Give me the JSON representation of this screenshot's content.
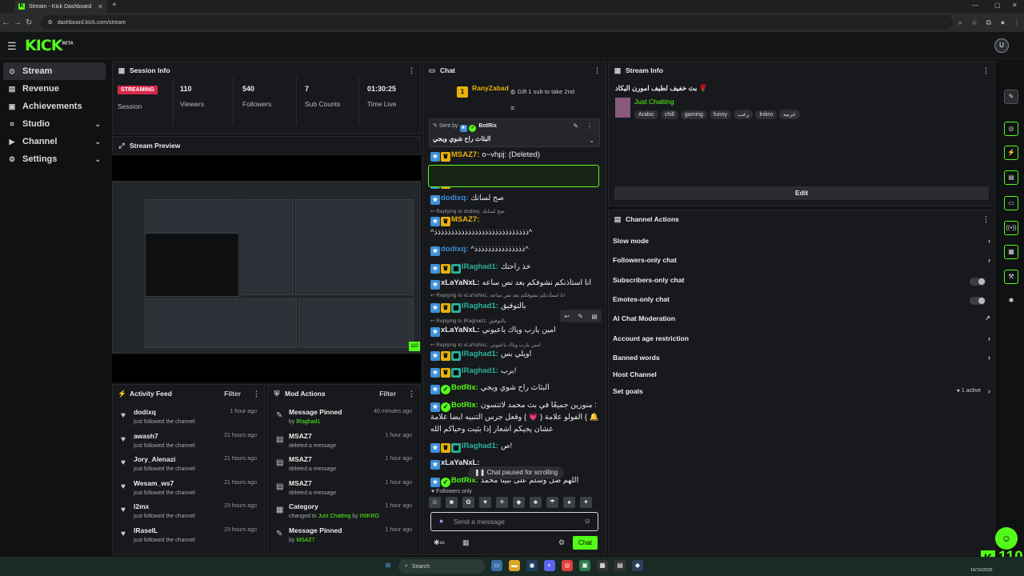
{
  "browser": {
    "tab_title": "Stream - Kick Dashboard",
    "url": "dashboard.kick.com/stream",
    "kick_icon": "K",
    "nav_icons": [
      "back-icon",
      "forward-icon",
      "reload-icon",
      "site-info-icon"
    ],
    "addr_icons": [
      "zoom-icon",
      "star-icon",
      "extensions-icon",
      "profile-icon",
      "menu-icon"
    ]
  },
  "app": {
    "logo": "KICK",
    "logo_beta": "BETA",
    "avatar": "U"
  },
  "sidebar": {
    "items": [
      {
        "label": "Stream",
        "icon": "stream-icon",
        "glyph": "((•))",
        "expandable": false,
        "active": true
      },
      {
        "label": "Revenue",
        "icon": "revenue-icon",
        "glyph": "▤",
        "expandable": false
      },
      {
        "label": "Achievements",
        "icon": "trophy-icon",
        "glyph": "▣",
        "expandable": false
      },
      {
        "label": "Studio",
        "icon": "studio-icon",
        "glyph": "⌗",
        "expandable": true
      },
      {
        "label": "Channel",
        "icon": "channel-icon",
        "glyph": "▶",
        "expandable": true
      },
      {
        "label": "Settings",
        "icon": "gear-icon",
        "glyph": "⚙",
        "expandable": true
      }
    ]
  },
  "session": {
    "title": "Session Info",
    "status_badge": "STREAMING",
    "status_label": "Session",
    "stats": [
      {
        "value": "110",
        "label": "Viewers"
      },
      {
        "value": "540",
        "label": "Followers"
      },
      {
        "value": "7",
        "label": "Sub Counts"
      },
      {
        "value": "01:30:25",
        "label": "Time Live"
      }
    ]
  },
  "preview": {
    "title": "Stream Preview",
    "viewer_count": "110"
  },
  "activity": {
    "title": "Activity Feed",
    "filter": "Filter",
    "items": [
      {
        "name": "dodixq",
        "desc": "just followed the channel",
        "time": "1 hour ago"
      },
      {
        "name": "awash7",
        "desc": "just followed the channel",
        "time": "21 hours ago"
      },
      {
        "name": "Jory_Alenazi",
        "desc": "just followed the channel",
        "time": "21 hours ago"
      },
      {
        "name": "Wesam_ws7",
        "desc": "just followed the channel",
        "time": "21 hours ago"
      },
      {
        "name": "l2mx",
        "desc": "just followed the channel",
        "time": "23 hours ago"
      },
      {
        "name": "lRaseIL",
        "desc": "just followed the channel",
        "time": "23 hours ago"
      }
    ]
  },
  "mod": {
    "title": "Mod Actions",
    "filter": "Filter",
    "items": [
      {
        "name": "Message Pinned",
        "pre": "by ",
        "who": "lRaghad1",
        "post": "",
        "desc2": "",
        "time": "40 minutes ago",
        "icon": "pin-icon",
        "glyph": "✎"
      },
      {
        "name": "MSAZ7",
        "pre": "deleted a message",
        "who": "",
        "post": "",
        "desc2": "",
        "time": "1 hour ago",
        "icon": "trash-icon",
        "glyph": "🗑"
      },
      {
        "name": "MSAZ7",
        "pre": "deleted a message",
        "who": "",
        "post": "",
        "desc2": "",
        "time": "1 hour ago",
        "icon": "trash-icon",
        "glyph": "🗑"
      },
      {
        "name": "MSAZ7",
        "pre": "deleted a message",
        "who": "",
        "post": "",
        "desc2": "",
        "time": "1 hour ago",
        "icon": "trash-icon",
        "glyph": "🗑"
      },
      {
        "name": "Category",
        "pre": "changed to ",
        "who": "Just Chatting",
        "post": " by ",
        "desc2": "INIKRO",
        "time": "1 hour ago",
        "icon": "category-icon",
        "glyph": "▦"
      },
      {
        "name": "Message Pinned",
        "pre": "by ",
        "who": "MSAZ7",
        "post": "",
        "desc2": "",
        "time": "1 hour ago",
        "icon": "pin-icon",
        "glyph": "✎"
      }
    ]
  },
  "chat": {
    "title": "Chat",
    "gifter": "RanyZabad",
    "gifter_count": "1",
    "gift_text": "Gift 1 sub to take 2nd",
    "pinned_by": "Sent by",
    "pinned_user": "BotRix",
    "pinned_text": "البثاث راح شوي ويجي",
    "messages": [
      {
        "user": "MSAZ7:",
        "text": "o~vhpj: (Deleted)",
        "color": "#e6b10c"
      },
      {
        "reply": "Replying to INIKRO: اخر 7:30 يمي يحوش القطات شوي"
      },
      {
        "user": "MSAZ7:",
        "text": "خذ راحتك",
        "color": "#e6b10c"
      },
      {
        "user": "dodixq:",
        "text": "صح لسانك",
        "color": "#3e8fd8"
      },
      {
        "reply": "Replying to dodixq: صح لسانك"
      },
      {
        "user": "MSAZ7:",
        "text": "",
        "color": "#e6b10c"
      },
      {
        "user": "",
        "text": "^ذذذذذذذذذذذذذذذذذذذذذذذذذذذذ^",
        "color": "#eee"
      },
      {
        "user": "dodixq:",
        "text": "^ذذذذذذذذذذذذذذذ^",
        "color": "#3e8fd8"
      },
      {
        "user": "lRaghad1:",
        "text": "خذ راحتك",
        "color": "#2bb39a"
      },
      {
        "user": "xLaYaNxL:",
        "text": "انا استأذنكم نشوفكم بعد نص ساعه",
        "color": "#eee"
      },
      {
        "reply": "Replying to xLaYaNxL: انا استأذنكم نشوفكم بعد نص ساعه"
      },
      {
        "user": "lRaghad1:",
        "text": "بالتوفيق",
        "color": "#2bb39a"
      },
      {
        "reply": "Replying to lRaghad1: بالتوفيق"
      },
      {
        "user": "xLaYaNxL:",
        "text": "امين يارب وياك ياعيوني",
        "color": "#eee"
      },
      {
        "reply": "Replying to xLaYaNxL: امين يارب وياك ياعيوني"
      },
      {
        "user": "lRaghad1:",
        "text": "اويلي بس",
        "color": "#2bb39a"
      },
      {
        "user": "lRaghad1:",
        "text": "برب!",
        "color": "#2bb39a"
      },
      {
        "user": "BotRix:",
        "text": "البثاث راح شوي ويجي",
        "color": "#53fc18"
      },
      {
        "user": "BotRix:",
        "text": "منورين جميعًا في بث محمد لاتنسون :",
        "color": "#53fc18"
      },
      {
        "user": "",
        "text": "الفولو علامة { 💗 } وفعل جرس التنبيه ايضاً علامة { 🔔 }",
        "color": "#eee"
      },
      {
        "user": "",
        "text": "عشان يجيكم أشعار إذا بثيت وحياكم الله",
        "color": "#eee"
      },
      {
        "user": "lRaghad1:",
        "text": "ص!",
        "color": "#2bb39a"
      },
      {
        "user": "xLaYaNxL:",
        "text": "",
        "color": "#eee"
      },
      {
        "user": "BotRix:",
        "text": "اللهم صل وسلم على نبينا محمد",
        "color": "#53fc18"
      }
    ],
    "paused": "Chat paused for scrolling",
    "followers_only": "Followers only",
    "placeholder": "Send a message",
    "send": "Chat"
  },
  "stream_info": {
    "title": "Stream Info",
    "stream_title": "بث خفيف لطيف امورن اليكاد 🌹",
    "category": "Just Chatting",
    "tags": [
      "Arabic",
      "chill",
      "gaming",
      "funny",
      "رعب",
      "lnikro",
      "عربيه"
    ],
    "edit": "Edit"
  },
  "channel_actions": {
    "title": "Channel Actions",
    "items": [
      {
        "label": "Slow mode",
        "type": "chevron"
      },
      {
        "label": "Followers-only chat",
        "type": "chevron"
      },
      {
        "label": "Subscribers-only chat",
        "type": "toggle"
      },
      {
        "label": "Emotes-only chat",
        "type": "toggle"
      },
      {
        "label": "AI Chat Moderation",
        "type": "external"
      },
      {
        "label": "Account age restriction",
        "type": "chevron"
      },
      {
        "label": "Banned words",
        "type": "chevron"
      },
      {
        "label": "Host Channel",
        "type": "none"
      },
      {
        "label": "Set goals",
        "type": "chevron",
        "extra": "1 active"
      }
    ]
  },
  "rail": [
    "edit-icon",
    "camera-icon",
    "bolt-icon",
    "doc-icon",
    "chat-bubble-icon",
    "broadcast-icon",
    "layout-icon",
    "wrench-icon",
    "apps-icon"
  ],
  "taskbar": {
    "search": "Search",
    "date": "10/16/2025"
  },
  "overlay": {
    "viewers": "110",
    "kick_icon": "K"
  }
}
